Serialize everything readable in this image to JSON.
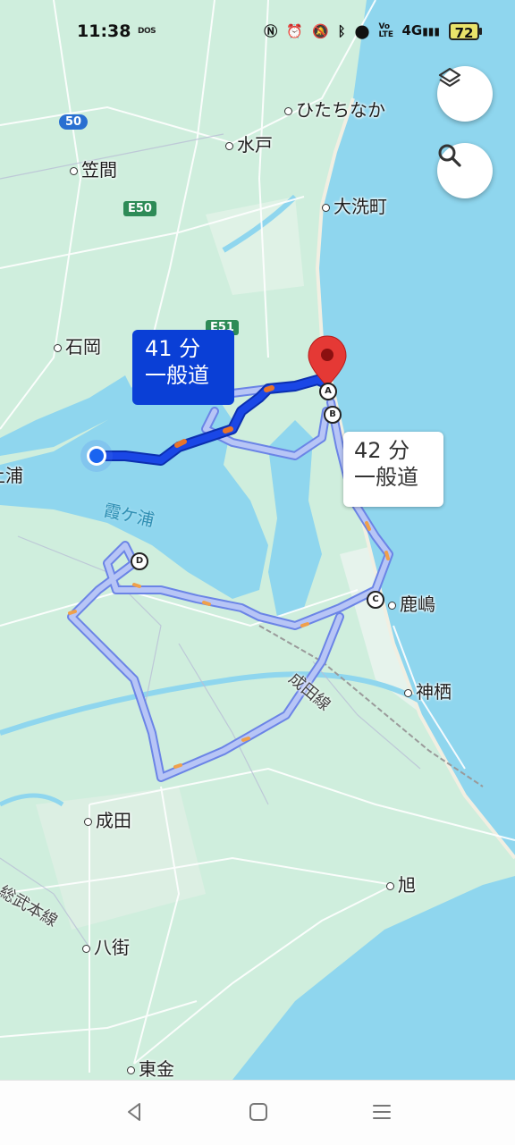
{
  "status_bar": {
    "time": "11:38",
    "dos_indicator": "DOS",
    "icons": [
      "nfc-icon",
      "alarm-icon",
      "mute-icon",
      "bluetooth-icon",
      "location-icon",
      "volte-icon",
      "signal-4g-icon",
      "battery-icon"
    ],
    "volte_text": "Vo\nLTE",
    "network_text": "4G",
    "battery_level": "72"
  },
  "map": {
    "places": {
      "hitachinaka": "ひたちなか",
      "mito": "水戸",
      "kasama": "笠間",
      "oarai": "大洗町",
      "ishioka": "石岡",
      "tsuchiura": "土浦",
      "kasumigaura": "霞ケ浦",
      "kashima": "鹿嶋",
      "kamisu": "神栖",
      "narita": "成田",
      "asahi": "旭",
      "yachimata": "八街",
      "togane": "東金"
    },
    "rail_lines": {
      "narita_line": "成田線",
      "sobu_line": "総武本線"
    },
    "road_shields": {
      "route_50": "50",
      "e50": "E50",
      "e51": "E51"
    },
    "waypoints": [
      "A",
      "B",
      "C",
      "D"
    ]
  },
  "routes": {
    "primary": {
      "duration": "41 分",
      "road_type": "一般道"
    },
    "alternate": {
      "duration": "42 分",
      "road_type": "一般道"
    }
  },
  "controls": {
    "layers_button": "layers-icon",
    "search_button": "search-icon"
  },
  "nav_bar": {
    "back": "back-icon",
    "home": "home-icon",
    "menu": "menu-icon"
  },
  "colors": {
    "route_primary": "#1a47e6",
    "route_alternate": "#a8b8f5",
    "water": "#8fd6ee",
    "land": "#cfeedd",
    "destination_pin": "#e53935"
  }
}
